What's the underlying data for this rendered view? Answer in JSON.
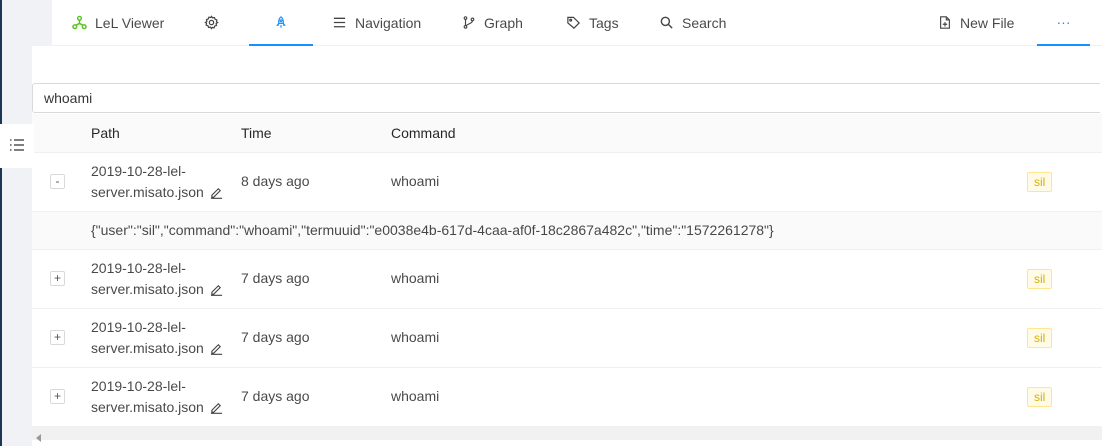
{
  "nav": {
    "items": [
      {
        "label": "LeL Viewer",
        "icon": "network-icon"
      },
      {
        "label": "",
        "icon": "gear-icon"
      },
      {
        "label": "",
        "icon": "rocket-icon"
      },
      {
        "label": "Navigation",
        "icon": "menu-icon"
      },
      {
        "label": "Graph",
        "icon": "branch-icon"
      },
      {
        "label": "Tags",
        "icon": "tag-icon"
      },
      {
        "label": "Search",
        "icon": "search-icon"
      },
      {
        "label": "New File",
        "icon": "file-add-icon"
      },
      {
        "label": "···",
        "icon": "more-icon"
      }
    ],
    "active_index": 2,
    "accent_color": "#1890ff"
  },
  "search": {
    "value": "whoami"
  },
  "table": {
    "columns": [
      "Path",
      "Time",
      "Command"
    ],
    "rows": [
      {
        "expand": "-",
        "path_line1": "2019-10-28-lel-",
        "path_line2": "server.misato.json",
        "time": "8 days ago",
        "command": "whoami",
        "tag": "sil",
        "expanded": true,
        "detail": "{\"user\":\"sil\",\"command\":\"whoami\",\"termuuid\":\"e0038e4b-617d-4caa-af0f-18c2867a482c\",\"time\":\"1572261278\"}"
      },
      {
        "expand": "+",
        "path_line1": "2019-10-28-lel-",
        "path_line2": "server.misato.json",
        "time": "7 days ago",
        "command": "whoami",
        "tag": "sil",
        "expanded": false
      },
      {
        "expand": "+",
        "path_line1": "2019-10-28-lel-",
        "path_line2": "server.misato.json",
        "time": "7 days ago",
        "command": "whoami",
        "tag": "sil",
        "expanded": false
      },
      {
        "expand": "+",
        "path_line1": "2019-10-28-lel-",
        "path_line2": "server.misato.json",
        "time": "7 days ago",
        "command": "whoami",
        "tag": "sil",
        "expanded": false
      }
    ]
  },
  "colors": {
    "tag_text": "#d4b106",
    "tag_bg": "#fffbe6",
    "tag_border": "#ffe58f",
    "network_icon": "#52c41a"
  }
}
